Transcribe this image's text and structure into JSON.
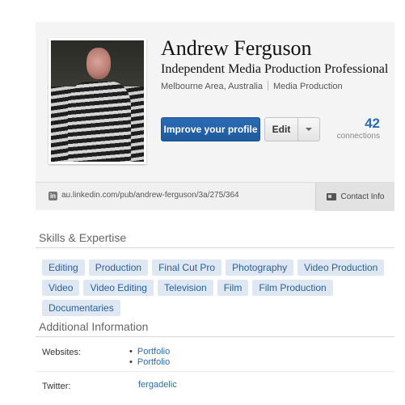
{
  "profile": {
    "name": "Andrew Ferguson",
    "headline": "Independent Media Production Professional",
    "location": "Melbourne Area, Australia",
    "industry": "Media Production",
    "improve_label": "Improve your profile",
    "edit_label": "Edit",
    "connections_count": "42",
    "connections_label": "connections",
    "public_url": "au.linkedin.com/pub/andrew-ferguson/3a/275/364",
    "linkedin_icon_glyph": "in",
    "contact_info_label": "Contact Info"
  },
  "skills": {
    "title": "Skills & Expertise",
    "items": [
      "Editing",
      "Production",
      "Final Cut Pro",
      "Photography",
      "Video Production",
      "Video",
      "Video Editing",
      "Television",
      "Film",
      "Film Production",
      "Documentaries"
    ]
  },
  "additional": {
    "title": "Additional Information",
    "websites_label": "Websites:",
    "websites": [
      "Portfolio",
      "Portfolio"
    ],
    "twitter_label": "Twitter:",
    "twitter_handle": "fergadelic"
  },
  "colors": {
    "accent_blue": "#1f5a9e",
    "link_blue": "#2a6cb0",
    "pill_bg": "#dfe8f2"
  }
}
